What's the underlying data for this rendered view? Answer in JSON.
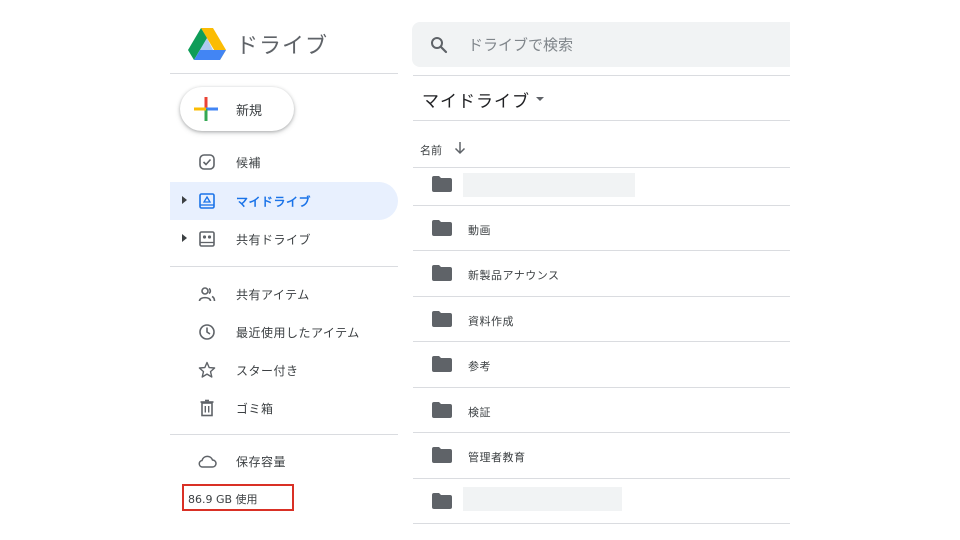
{
  "header": {
    "title": "ドライブ",
    "search_placeholder": "ドライブで検索"
  },
  "sidebar": {
    "new_button_label": "新規",
    "items": [
      {
        "label": "候補",
        "icon": "suggest-check-icon",
        "active": false
      },
      {
        "label": "マイドライブ",
        "icon": "my-drive-icon",
        "active": true
      },
      {
        "label": "共有ドライブ",
        "icon": "shared-drives-icon",
        "active": false
      },
      {
        "label": "共有アイテム",
        "icon": "shared-people-icon",
        "active": false
      },
      {
        "label": "最近使用したアイテム",
        "icon": "clock-icon",
        "active": false
      },
      {
        "label": "スター付き",
        "icon": "star-icon",
        "active": false
      },
      {
        "label": "ゴミ箱",
        "icon": "trash-icon",
        "active": false
      },
      {
        "label": "保存容量",
        "icon": "cloud-icon",
        "active": false
      }
    ],
    "storage_used": "86.9 GB 使用"
  },
  "main": {
    "breadcrumb": "マイドライブ",
    "column_name": "名前",
    "files": [
      {
        "name": "",
        "type": "folder"
      },
      {
        "name": "動画",
        "type": "folder"
      },
      {
        "name": "新製品アナウンス",
        "type": "folder"
      },
      {
        "name": "資料作成",
        "type": "folder"
      },
      {
        "name": "参考",
        "type": "folder"
      },
      {
        "name": "検証",
        "type": "folder"
      },
      {
        "name": "管理者教育",
        "type": "folder"
      },
      {
        "name": "",
        "type": "folder"
      }
    ]
  },
  "colors": {
    "accent": "#1a73e8",
    "active_bg": "#e8f0fe",
    "highlight_border": "#d93025",
    "search_bg": "#f1f3f4"
  }
}
